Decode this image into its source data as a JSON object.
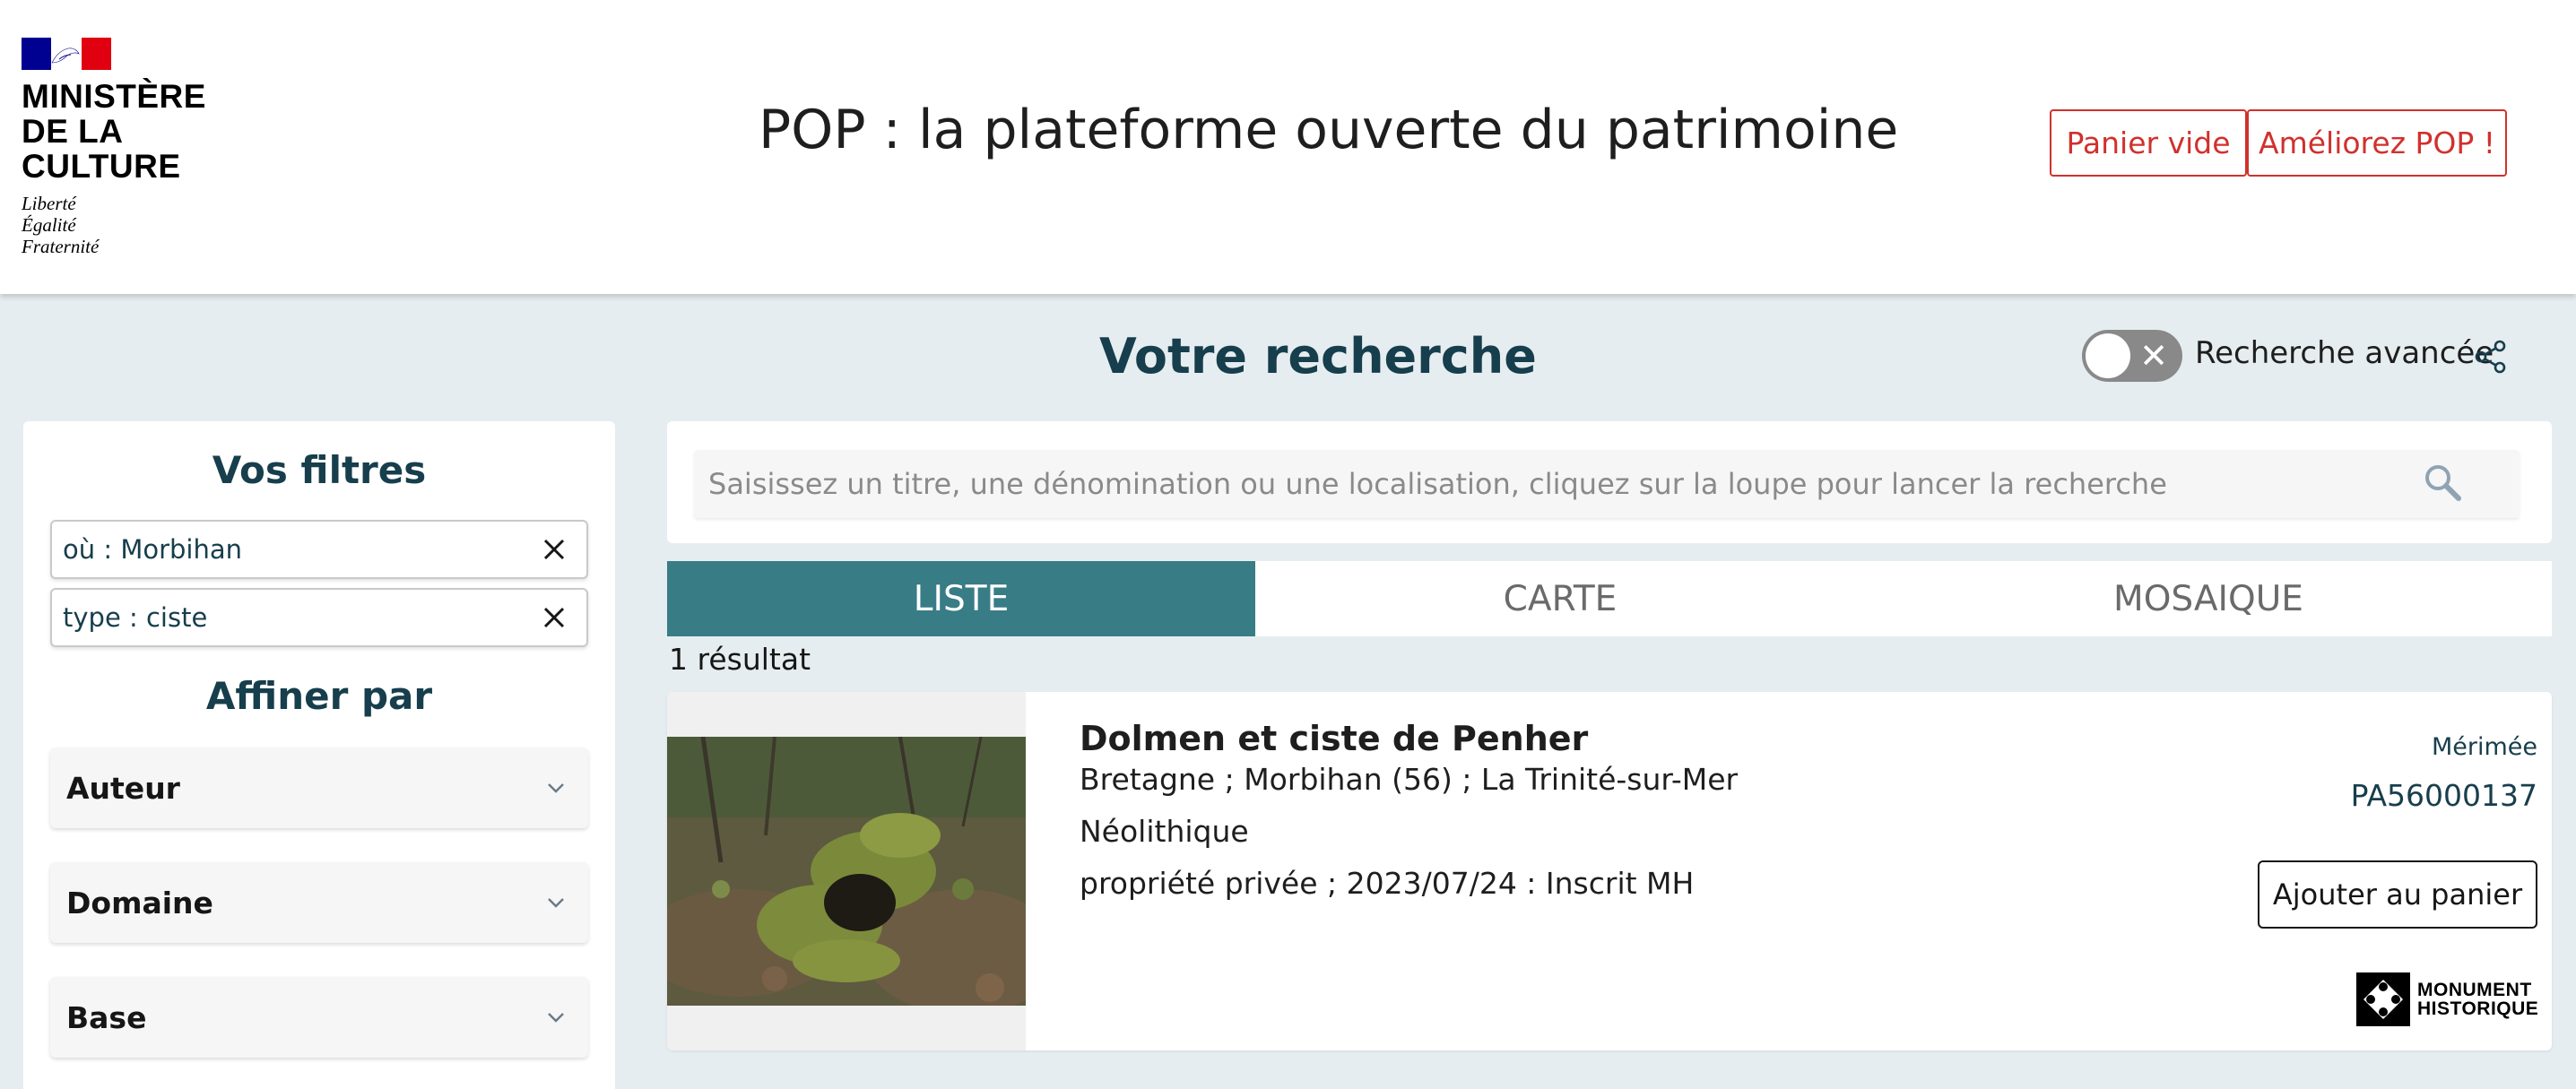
{
  "header": {
    "ministry_line1": "MINISTÈRE",
    "ministry_line2": "DE LA CULTURE",
    "motto_1": "Liberté",
    "motto_2": "Égalité",
    "motto_3": "Fraternité",
    "site_title": "POP : la plateforme ouverte du patrimoine",
    "panier_label": "Panier vide",
    "ameliorez_label": "Améliorez POP !"
  },
  "search": {
    "heading": "Votre recherche",
    "advanced_label": "Recherche avancée",
    "advanced_enabled": false,
    "placeholder": "Saisissez un titre, une dénomination ou une localisation, cliquez sur la loupe pour lancer la recherche"
  },
  "sidebar": {
    "filters_title": "Vos filtres",
    "active_filters": [
      {
        "label": "où : Morbihan"
      },
      {
        "label": "type : ciste"
      }
    ],
    "refine_title": "Affiner par",
    "facets": [
      {
        "label": "Auteur"
      },
      {
        "label": "Domaine"
      },
      {
        "label": "Base"
      }
    ]
  },
  "tabs": [
    {
      "label": "LISTE",
      "active": true
    },
    {
      "label": "CARTE",
      "active": false
    },
    {
      "label": "MOSAIQUE",
      "active": false
    }
  ],
  "results": {
    "count_label": "1 résultat",
    "items": [
      {
        "title": "Dolmen et ciste de Penher",
        "location": "Bretagne ; Morbihan (56) ; La Trinité-sur-Mer",
        "period": "Néolithique",
        "status": "propriété privée ; 2023/07/24 : Inscrit MH",
        "base": "Mérimée",
        "reference": "PA56000137",
        "cart_label": "Ajouter au panier",
        "badge_line1": "MONUMENT",
        "badge_line2": "HISTORIQUE"
      }
    ]
  },
  "colors": {
    "accent_red": "#d0312d",
    "teal": "#387c86",
    "dark_blue": "#173e4c",
    "background": "#e6edf0"
  },
  "icons": [
    "marianne-flag-icon",
    "share-icon",
    "close-icon",
    "chevron-down-icon",
    "search-icon",
    "monument-historique-icon"
  ]
}
